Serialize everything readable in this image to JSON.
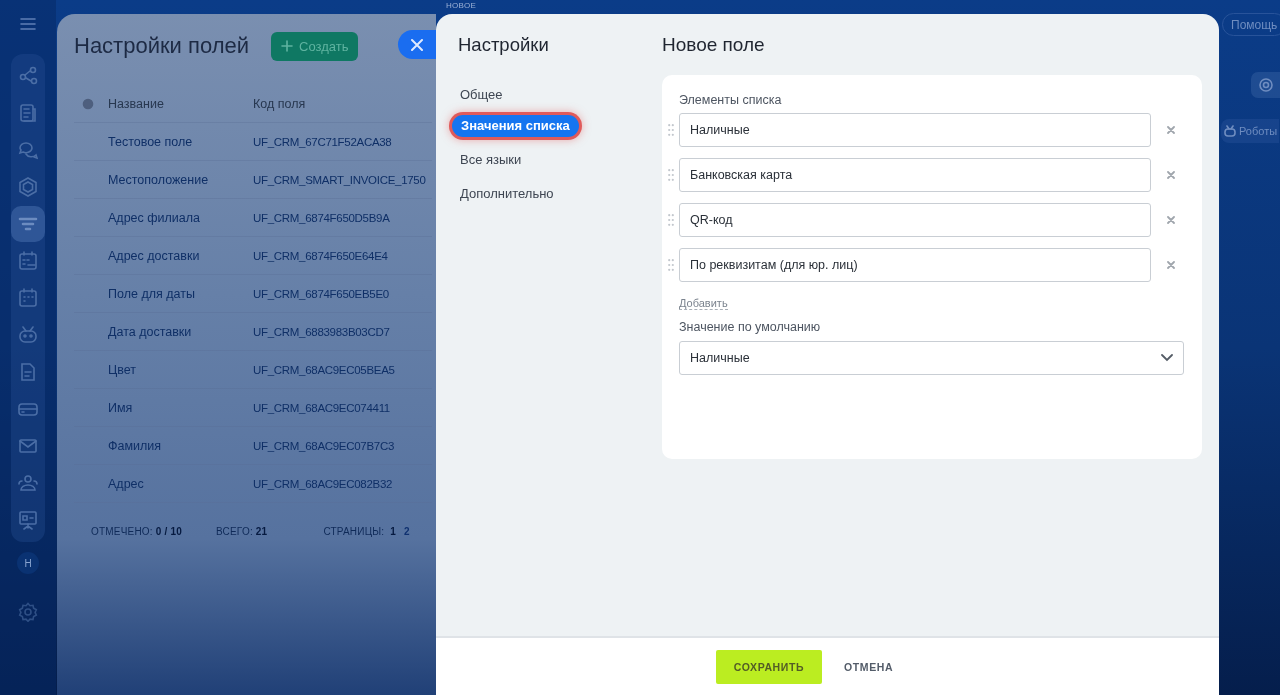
{
  "sidebar": {
    "items": [
      {
        "kind": "flow",
        "selected": false
      },
      {
        "kind": "doc",
        "selected": false
      },
      {
        "kind": "chat",
        "selected": false
      },
      {
        "kind": "hexagon",
        "selected": false
      },
      {
        "kind": "funnel",
        "selected": true
      },
      {
        "kind": "tasks",
        "selected": false
      },
      {
        "kind": "calendar",
        "selected": false
      },
      {
        "kind": "robot",
        "selected": false
      },
      {
        "kind": "file",
        "selected": false
      },
      {
        "kind": "card",
        "selected": false
      },
      {
        "kind": "mail",
        "selected": false
      },
      {
        "kind": "people",
        "selected": false
      },
      {
        "kind": "board",
        "selected": false
      }
    ],
    "avatar": "Н"
  },
  "top_bar": {
    "badge": "НОВОЕ",
    "help": "Помощь",
    "robots": "Роботы"
  },
  "background_page": {
    "title": "Настройки полей",
    "create_button": "Создать",
    "table": {
      "columns": [
        "Название",
        "Код поля"
      ],
      "rows": [
        [
          "Тестовое поле",
          "UF_CRM_67C71F52ACA38"
        ],
        [
          "Местоположение",
          "UF_CRM_SMART_INVOICE_1750"
        ],
        [
          "Адрес филиала",
          "UF_CRM_6874F650D5B9A"
        ],
        [
          "Адрес доставки",
          "UF_CRM_6874F650E64E4"
        ],
        [
          "Поле для даты",
          "UF_CRM_6874F650EB5E0"
        ],
        [
          "Дата доставки",
          "UF_CRM_6883983B03CD7"
        ],
        [
          "Цвет",
          "UF_CRM_68AC9EC05BEA5"
        ],
        [
          "Имя",
          "UF_CRM_68AC9EC074411"
        ],
        [
          "Фамилия",
          "UF_CRM_68AC9EC07B7C3"
        ],
        [
          "Адрес",
          "UF_CRM_68AC9EC082B32"
        ]
      ]
    },
    "footer": {
      "checked_label": "ОТМЕЧЕНО:",
      "checked_value": "0 / 10",
      "total_label": "ВСЕГО:",
      "total_value": "21",
      "pages_label": "СТРАНИЦЫ:",
      "pages": [
        {
          "label": "1",
          "selected": true
        },
        {
          "label": "2",
          "selected": false
        }
      ]
    }
  },
  "panel": {
    "nav_title": "Настройки",
    "nav": [
      {
        "label": "Общее",
        "selected": false
      },
      {
        "label": "Значения списка",
        "selected": true
      },
      {
        "label": "Все языки",
        "selected": false
      },
      {
        "label": "Дополнительно",
        "selected": false
      }
    ],
    "title": "Новое поле",
    "list_label": "Элементы списка",
    "list_items": [
      "Наличные",
      "Банковская карта",
      "QR-код",
      "По реквизитам (для юр. лиц)"
    ],
    "add_link": "Добавить",
    "default_label": "Значение по умолчанию",
    "default_value": "Наличные",
    "save": "СОХРАНИТЬ",
    "cancel": "ОТМЕНА"
  }
}
